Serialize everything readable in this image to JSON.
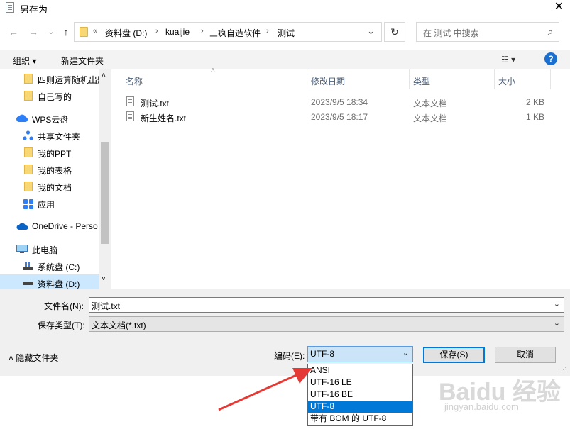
{
  "window": {
    "title": "另存为",
    "close": "✕"
  },
  "nav": {
    "back": "←",
    "forward": "→",
    "recent": "⌄",
    "up": "↑"
  },
  "address": {
    "overflow": "«",
    "crumbs": [
      "资料盘 (D:)",
      "kuaijie",
      "三疯自造软件",
      "测试"
    ],
    "sep": "›",
    "dropdown": "⌄",
    "refresh": "↻"
  },
  "search": {
    "placeholder": "在 测试 中搜索",
    "icon": "⌕"
  },
  "toolbar": {
    "organize": "组织 ▾",
    "new_folder": "新建文件夹",
    "view": "☷ ▾",
    "help": "?"
  },
  "sidebar": {
    "items": [
      {
        "label": "四则运算随机出题"
      },
      {
        "label": "自己写的"
      },
      {
        "label": "WPS云盘"
      },
      {
        "label": "共享文件夹"
      },
      {
        "label": "我的PPT"
      },
      {
        "label": "我的表格"
      },
      {
        "label": "我的文档"
      },
      {
        "label": "应用"
      },
      {
        "label": "OneDrive - Perso"
      },
      {
        "label": "此电脑"
      },
      {
        "label": "系统盘 (C:)"
      },
      {
        "label": "资料盘 (D:)"
      }
    ],
    "scroll_up": "˄",
    "scroll_down": "˅"
  },
  "filelist": {
    "sort_arrow": "˄",
    "columns": [
      "名称",
      "修改日期",
      "类型",
      "大小"
    ],
    "rows": [
      {
        "name": "测试.txt",
        "date": "2023/9/5 18:34",
        "type": "文本文档",
        "size": "2 KB"
      },
      {
        "name": "新生姓名.txt",
        "date": "2023/9/5 18:17",
        "type": "文本文档",
        "size": "1 KB"
      }
    ]
  },
  "form": {
    "filename_label": "文件名(N):",
    "filename_value": "测试.txt",
    "filetype_label": "保存类型(T):",
    "filetype_value": "文本文档(*.txt)",
    "chevron": "⌄",
    "hide_folders": "˄ 隐藏文件夹",
    "encoding_label": "编码(E):",
    "encoding_value": "UTF-8",
    "save": "保存(S)",
    "cancel": "取消"
  },
  "encoding_options": [
    "ANSI",
    "UTF-16 LE",
    "UTF-16 BE",
    "UTF-8",
    "带有 BOM 的 UTF-8"
  ],
  "colors": {
    "accent": "#0078d7",
    "arrow": "#e53935",
    "selection": "#cce8ff"
  },
  "watermark": {
    "logo": "Baidu 经验",
    "url": "jingyan.baidu.com"
  }
}
